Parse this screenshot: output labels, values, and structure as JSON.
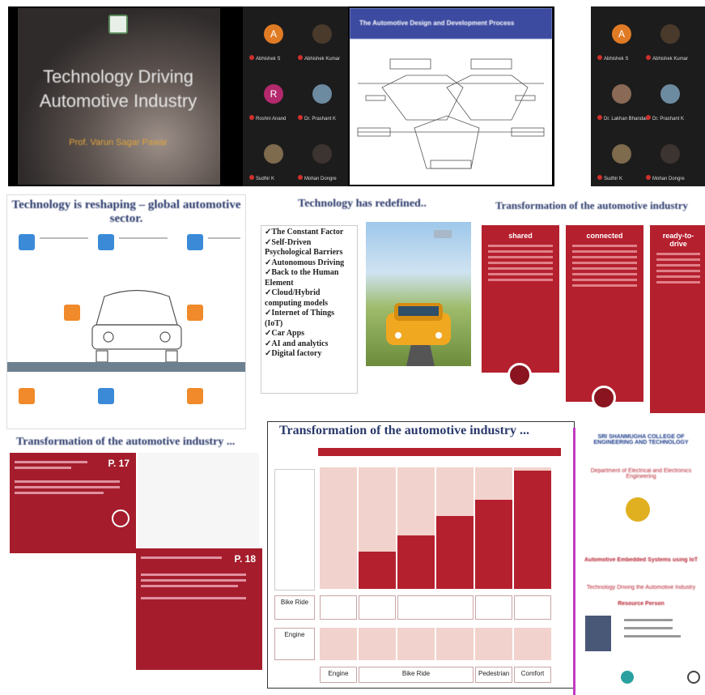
{
  "tiles": {
    "title_slide": {
      "title": "Technology Driving Automotive Industry",
      "subtitle": "Prof. Varun Sagar Pawar"
    },
    "participants_left": [
      {
        "initial": "A",
        "name": "Abhishek S",
        "color": "#e07b25"
      },
      {
        "initial": "",
        "name": "Abhishek Kumar",
        "color": "#4a3a2c"
      },
      {
        "initial": "R",
        "name": "Roshni Anand",
        "color": "#b4286c"
      },
      {
        "initial": "",
        "name": "Dr. Prashant K",
        "color": "#6c8aa0"
      },
      {
        "initial": "",
        "name": "Sudhir K",
        "color": "#7e6a4c"
      },
      {
        "initial": "",
        "name": "Mohan Dongre",
        "color": "#3c3430"
      }
    ],
    "participants_right": [
      {
        "initial": "A",
        "name": "Abhishek S",
        "color": "#e07b25"
      },
      {
        "initial": "",
        "name": "Abhishek Kumar",
        "color": "#4a3a2c"
      },
      {
        "initial": "",
        "name": "Dr. Lakhan Bhandari",
        "color": "#8a6a56"
      },
      {
        "initial": "",
        "name": "Dr. Prashant K",
        "color": "#6c8aa0"
      },
      {
        "initial": "",
        "name": "Sudhir K",
        "color": "#7e6a4c"
      },
      {
        "initial": "",
        "name": "Mohan Dongre",
        "color": "#3c3430"
      }
    ],
    "diagram_slide": {
      "title": "The Automotive Design and Development Process"
    },
    "reshaping_slide": {
      "title": "Technology is reshaping – global automotive sector."
    },
    "redefined_slide": {
      "title": "Technology has redefined..",
      "items": [
        "The Constant Factor",
        "Self-Driven Psychological Barriers",
        "Autonomous Driving",
        "Back to the Human Element",
        "Cloud/Hybrid computing models",
        "Internet of Things (IoT)",
        "Car Apps",
        "AI and analytics",
        "Digital factory"
      ]
    },
    "transformation_cols": {
      "title": "Transformation of the automotive industry",
      "columns": [
        "shared",
        "connected",
        "ready-to-drive"
      ]
    },
    "transformation_cards": {
      "title": "Transformation of the automotive industry ...",
      "page_top": "P. 17",
      "page_bottom": "P. 18"
    },
    "transformation_table": {
      "title": "Transformation of the automotive industry ...",
      "row_labels": [
        "Bike Ride",
        "Engine"
      ],
      "bottom_labels": [
        "Engine",
        "Bike Ride",
        "Pedestrian",
        "Comfort"
      ]
    },
    "poster": {
      "college": "SRI SHANMUGHA COLLEGE OF ENGINEERING AND TECHNOLOGY",
      "dept": "Department of Electrical and Electronics Engineering",
      "event": "Automotive Embedded Systems using IoT",
      "topic": "Technology Driving the Automotive Industry",
      "speaker": "Resource Person"
    }
  }
}
